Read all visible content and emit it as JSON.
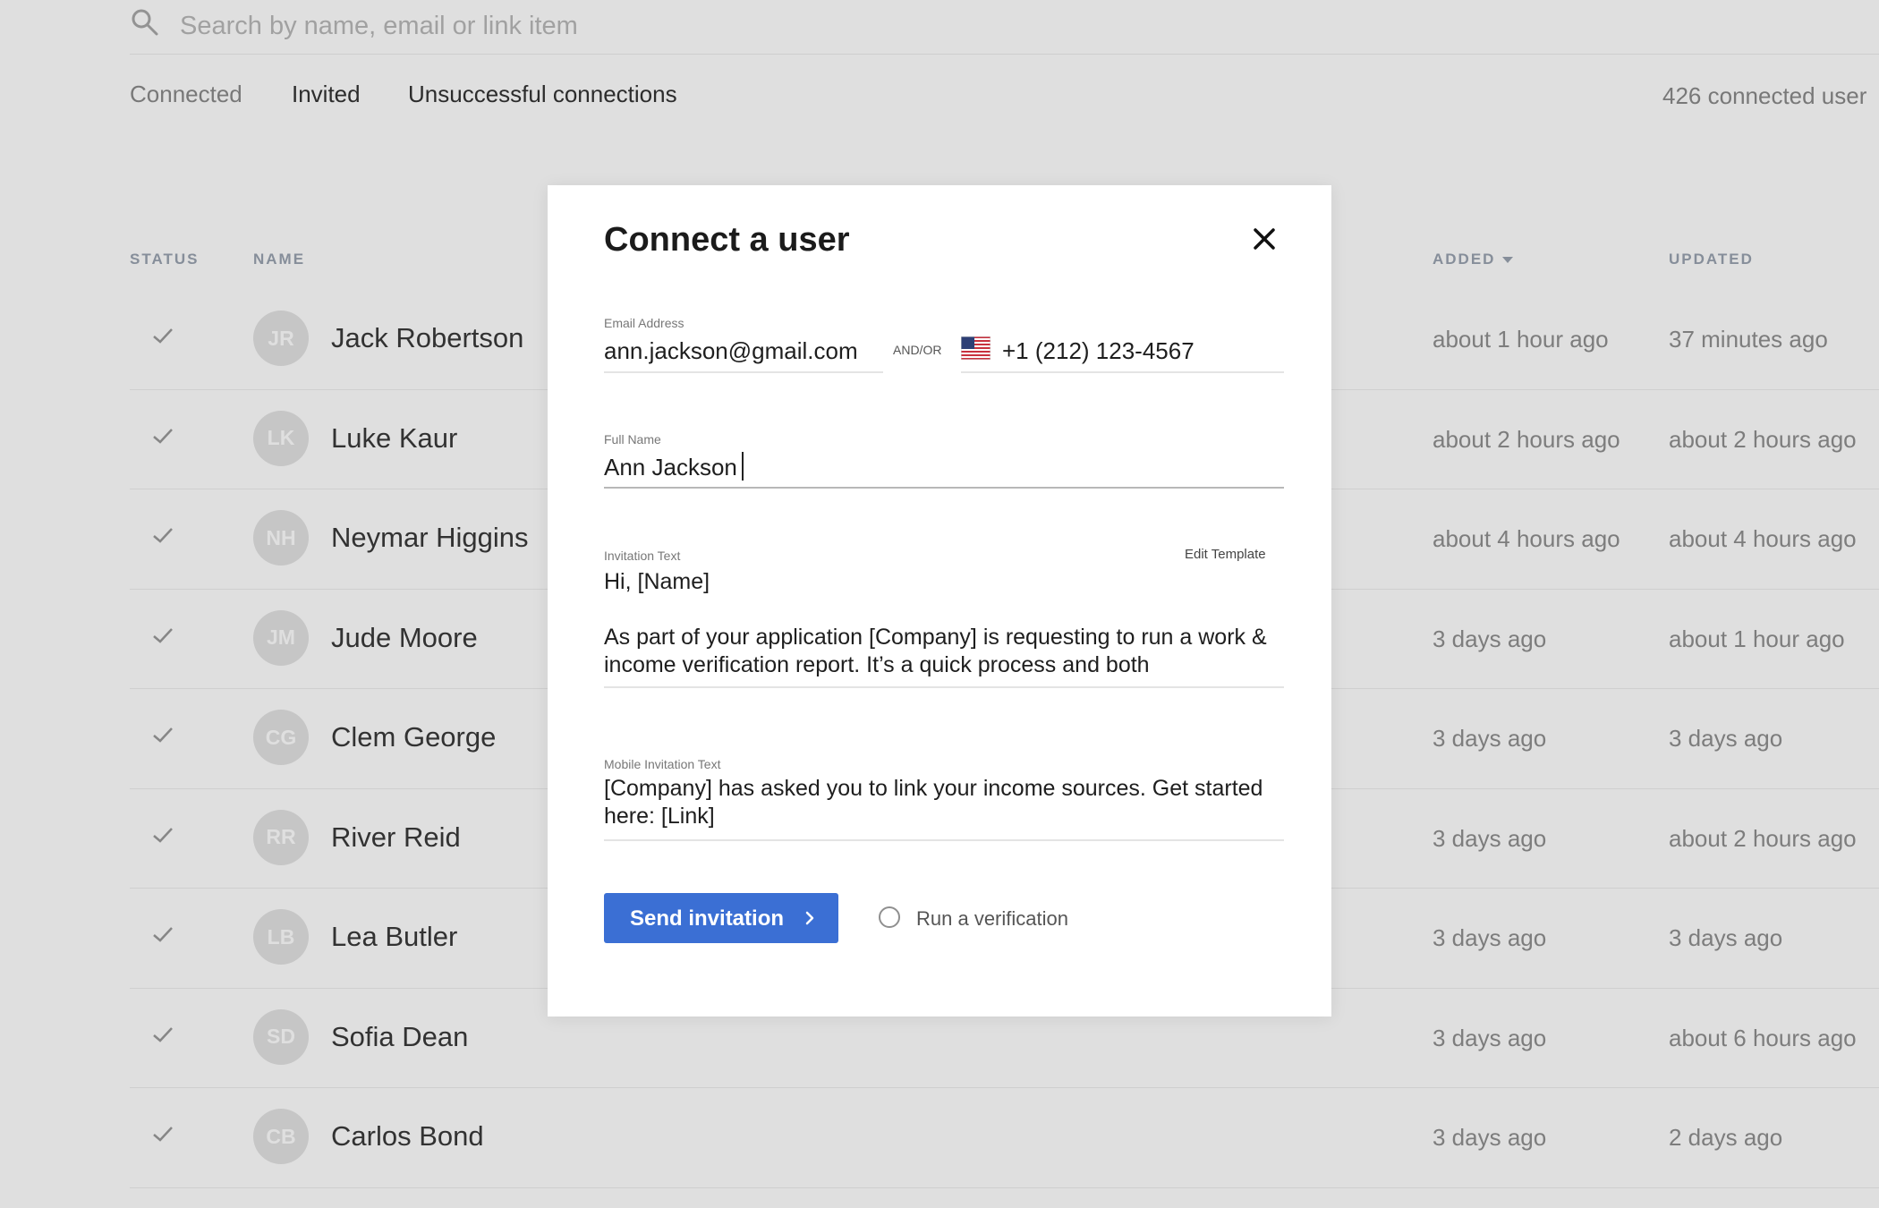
{
  "search": {
    "placeholder": "Search by name, email or link item",
    "value": ""
  },
  "tabs": [
    {
      "label": "Connected",
      "active": false
    },
    {
      "label": "Invited",
      "active": false
    },
    {
      "label": "Unsuccessful connections",
      "active": false
    }
  ],
  "connected_count": "426 connected user",
  "table": {
    "headers": {
      "status": "STATUS",
      "name": "NAME",
      "added": "ADDED",
      "updated": "UPDATED"
    },
    "rows": [
      {
        "initials": "JR",
        "name": "Jack Robertson",
        "added": "about 1 hour ago",
        "updated": "37 minutes ago"
      },
      {
        "initials": "LK",
        "name": "Luke Kaur",
        "added": "about 2 hours ago",
        "updated": "about 2 hours ago"
      },
      {
        "initials": "NH",
        "name": "Neymar Higgins",
        "added": "about 4 hours ago",
        "updated": "about 4 hours ago"
      },
      {
        "initials": "JM",
        "name": "Jude Moore",
        "added": "3 days ago",
        "updated": "about 1 hour ago"
      },
      {
        "initials": "CG",
        "name": "Clem George",
        "added": "3 days ago",
        "updated": "3 days ago"
      },
      {
        "initials": "RR",
        "name": "River Reid",
        "added": "3 days ago",
        "updated": "about 2 hours ago"
      },
      {
        "initials": "LB",
        "name": "Lea Butler",
        "added": "3 days ago",
        "updated": "3 days ago"
      },
      {
        "initials": "SD",
        "name": "Sofia Dean",
        "added": "3 days ago",
        "updated": "about 6 hours ago"
      },
      {
        "initials": "CB",
        "name": "Carlos Bond",
        "added": "3 days ago",
        "updated": "2 days ago"
      }
    ]
  },
  "modal": {
    "title": "Connect a user",
    "email": {
      "label": "Email Address",
      "value": "ann.jackson@gmail.com"
    },
    "andor": "AND/OR",
    "phone": {
      "value": "+1 (212) 123-4567",
      "flag": "us-flag-icon"
    },
    "full_name": {
      "label": "Full Name",
      "value": "Ann Jackson"
    },
    "invitation": {
      "label": "Invitation Text",
      "edit_template": "Edit Template",
      "greeting": "Hi, [Name]",
      "body": "As part of your application [Company] is requesting to run a work & income verification report. It’s a quick process and both"
    },
    "mobile_invitation": {
      "label": "Mobile Invitation Text",
      "text": "[Company] has asked you to link your income sources. Get started here: [Link]"
    },
    "send_button": "Send invitation",
    "run_verification": "Run a verification"
  },
  "colors": {
    "primary_button": "#3b6fd4",
    "overlay": "rgba(0,0,0,0.125)",
    "muted_text": "#8f8f8f"
  }
}
